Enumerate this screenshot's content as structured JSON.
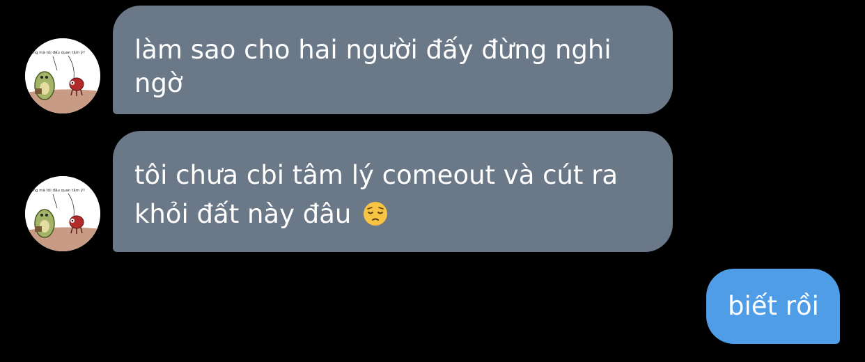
{
  "messages": [
    {
      "direction": "incoming",
      "text": "làm sao cho hai người đấy đừng nghi ngờ",
      "avatar_caption": "ưng mà tôi đâu quan tâm ý?"
    },
    {
      "direction": "incoming",
      "text": "tôi chưa cbi tâm lý comeout và cút ra khỏi đất này đâu",
      "emoji": "pensive-face-emoji",
      "avatar_caption": "ưng mà tôi đâu quan tâm ý?"
    },
    {
      "direction": "outgoing",
      "text": "biết rồi"
    }
  ],
  "colors": {
    "background": "#000000",
    "incoming_bubble": "#6b7888",
    "outgoing_bubble": "#4f9de6",
    "text": "#ffffff"
  }
}
